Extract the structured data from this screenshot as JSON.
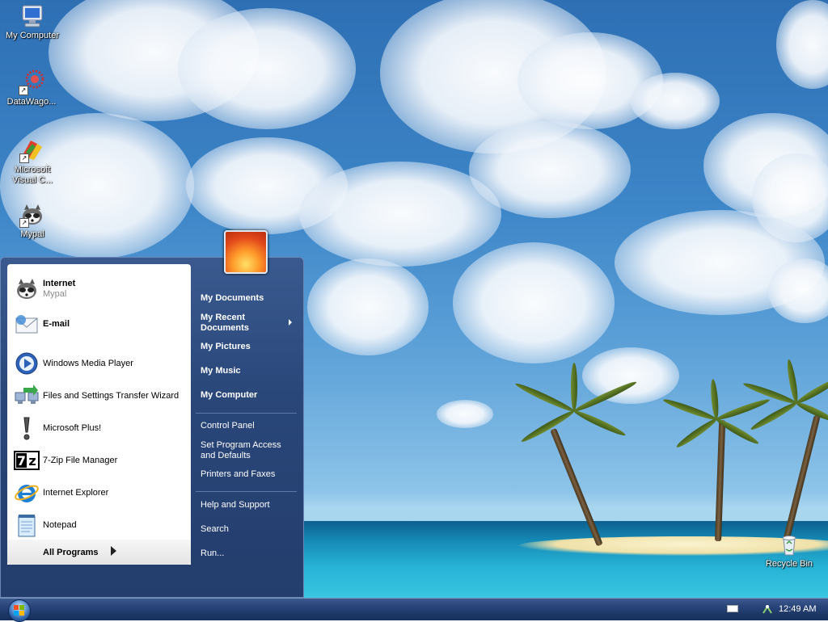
{
  "desktop": {
    "icons": [
      {
        "label": "My Computer",
        "icon": "my-computer-icon"
      },
      {
        "label": "DataWago...",
        "icon": "datawagon-icon"
      },
      {
        "label": "Microsoft Visual C...",
        "icon": "visual-studio-icon"
      },
      {
        "label": "Mypal",
        "icon": "mypal-icon"
      },
      {
        "label": "Recycle Bin",
        "icon": "recycle-bin-icon"
      }
    ]
  },
  "start_menu": {
    "pinned": [
      {
        "label": "Internet",
        "sublabel": "Mypal",
        "icon": "mypal-icon"
      },
      {
        "label": "E-mail",
        "icon": "mail-icon"
      }
    ],
    "recent_programs": [
      {
        "label": "Windows Media Player",
        "icon": "media-player-icon"
      },
      {
        "label": "Files and Settings Transfer Wizard",
        "icon": "transfer-wizard-icon"
      },
      {
        "label": "Microsoft Plus!",
        "icon": "exclamation-icon"
      },
      {
        "label": "7-Zip File Manager",
        "icon": "seven-zip-icon"
      },
      {
        "label": "Internet Explorer",
        "icon": "internet-explorer-icon"
      },
      {
        "label": "Notepad",
        "icon": "notepad-icon"
      }
    ],
    "all_programs_label": "All Programs",
    "right_column": {
      "my_documents": "My Documents",
      "my_recent_documents_line1": "My Recent",
      "my_recent_documents_line2": "Documents",
      "my_pictures": "My Pictures",
      "my_music": "My Music",
      "my_computer": "My Computer",
      "control_panel": "Control Panel",
      "set_program_access_line1": "Set Program Access",
      "set_program_access_line2": "and Defaults",
      "printers_and_faxes": "Printers and Faxes",
      "help_and_support": "Help and Support",
      "search": "Search",
      "run": "Run..."
    }
  },
  "taskbar": {
    "clock": "12:49 AM",
    "start_icon": "windows-flag-icon"
  },
  "colors": {
    "taskbar": "#1d3766",
    "start_menu_right": "#2a477a",
    "start_menu_left": "#ffffff"
  }
}
